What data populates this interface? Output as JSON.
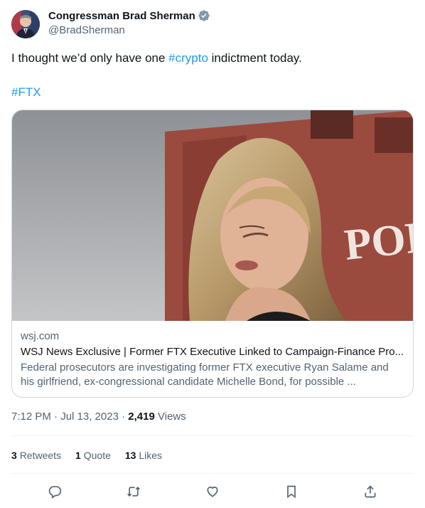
{
  "author": {
    "display_name": "Congressman Brad Sherman",
    "handle": "@BradSherman",
    "verified_icon": "verified-badge-gray"
  },
  "tweet": {
    "text_before": "I thought we’d only have one ",
    "hashtag_inline": "#crypto",
    "text_after": " indictment today.",
    "hashtag_line": "#FTX"
  },
  "card": {
    "image_text": "POR",
    "domain": "wsj.com",
    "title": "WSJ News Exclusive | Former FTX Executive Linked to Campaign-Finance Pro...",
    "description": "Federal prosecutors are investigating former FTX executive Ryan Salame and his girlfriend, ex-congressional candidate Michelle Bond, for possible ..."
  },
  "meta": {
    "timestamp": "7:12 PM · Jul 13, 2023",
    "separator": " · ",
    "views_count": "2,419",
    "views_label": "Views"
  },
  "stats": {
    "retweets_count": "3",
    "retweets_label": "Retweets",
    "quotes_count": "1",
    "quotes_label": "Quote",
    "likes_count": "13",
    "likes_label": "Likes"
  },
  "actions": [
    "reply-icon",
    "retweet-icon",
    "like-icon",
    "bookmark-icon",
    "share-icon"
  ],
  "colors": {
    "link": "#1d9bf0",
    "text": "#0f1419",
    "secondary": "#536471",
    "border": "#cfd9de"
  }
}
